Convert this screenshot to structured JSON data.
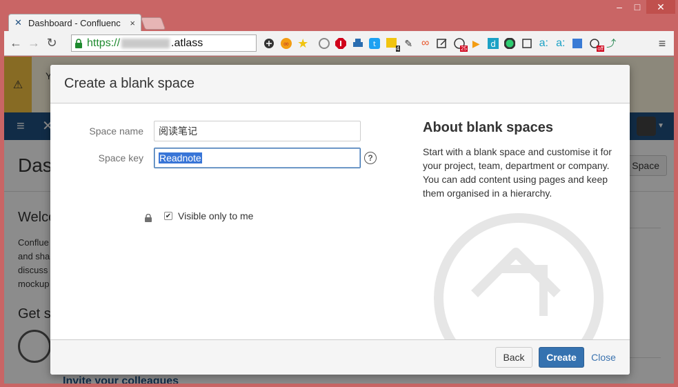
{
  "browser": {
    "tab_title": "Dashboard - Confluenc",
    "tab_close": "×",
    "url_scheme": "https://",
    "url_host": ".atlass",
    "window_controls": [
      "–",
      "□",
      "✕"
    ]
  },
  "toolbar": {
    "back": "←",
    "forward": "→",
    "reload": "↻",
    "menu": "≡",
    "extension_badges": {
      "ext_4": "4",
      "ext_25": "25",
      "ext_off": "off",
      "ext_1": "1"
    }
  },
  "background_page": {
    "warning_initial": "Y",
    "title": "Das",
    "create_space_button": "Space",
    "welcome_heading": "Welco",
    "welcome_text": "Conflue and sha discuss mockup",
    "get_started_heading": "Get s",
    "invite_link": "Invite your colleagues"
  },
  "dialog": {
    "title": "Create a blank space",
    "space_name_label": "Space name",
    "space_name_value": "阅读笔记",
    "space_key_label": "Space key",
    "space_key_value": "Readnote",
    "help_icon_glyph": "?",
    "visible_checkbox_checked": true,
    "visible_label": "Visible only to me",
    "about_title": "About blank spaces",
    "about_text": "Start with a blank space and customise it for your project, team, department or company. You can add content using pages and keep them organised in a hierarchy.",
    "back_button": "Back",
    "create_button": "Create",
    "close_button": "Close"
  },
  "colors": {
    "window_frame": "#c96565",
    "app_header": "#205081",
    "primary_button": "#3572b0",
    "link": "#3b73af",
    "warning": "#f6c342"
  }
}
